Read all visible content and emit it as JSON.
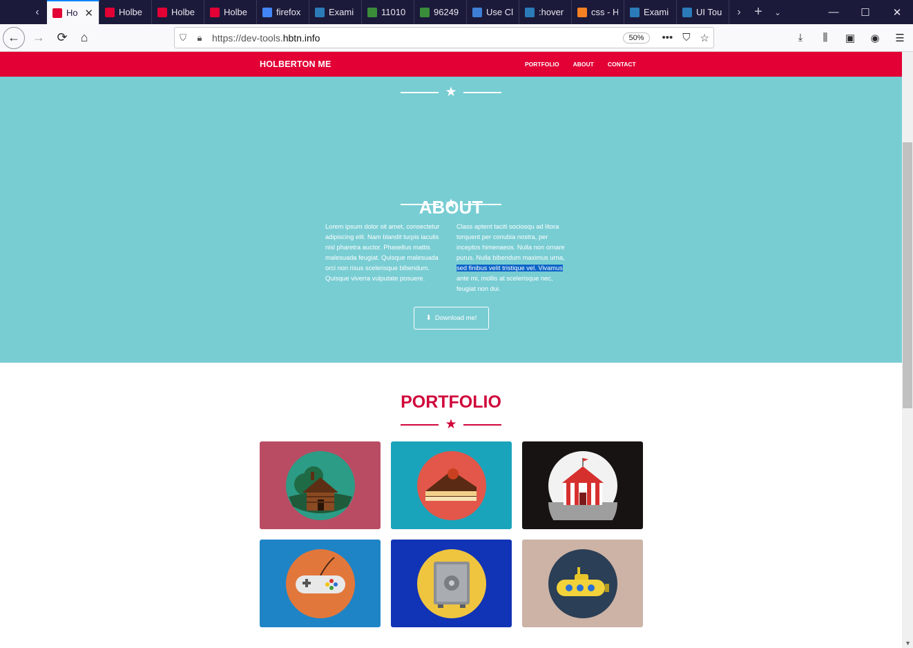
{
  "browser": {
    "tabs": [
      {
        "title": "Ho",
        "favicon": "seahorse-icon",
        "fav_color": "#e20035",
        "active": true
      },
      {
        "title": "Holbe",
        "favicon": "seahorse-icon",
        "fav_color": "#e20035"
      },
      {
        "title": "Holbe",
        "favicon": "seahorse-icon",
        "fav_color": "#e20035"
      },
      {
        "title": "Holbe",
        "favicon": "seahorse-icon",
        "fav_color": "#e20035"
      },
      {
        "title": "firefox",
        "favicon": "google-icon",
        "fav_color": "#4285f4"
      },
      {
        "title": "Exami",
        "favicon": "codepen-icon",
        "fav_color": "#2b7bb9"
      },
      {
        "title": "11010",
        "favicon": "bug-icon",
        "fav_color": "#3a8c3a"
      },
      {
        "title": "96249",
        "favicon": "bug-icon",
        "fav_color": "#3a8c3a"
      },
      {
        "title": "Use Cl",
        "favicon": "dots-icon",
        "fav_color": "#3d7fd6"
      },
      {
        "title": ":hover",
        "favicon": "codepen-icon",
        "fav_color": "#2b7bb9"
      },
      {
        "title": "css - H",
        "favicon": "stackoverflow-icon",
        "fav_color": "#f48024"
      },
      {
        "title": "Exami",
        "favicon": "codepen-icon",
        "fav_color": "#2b7bb9"
      },
      {
        "title": "UI Tou",
        "favicon": "codepen-icon",
        "fav_color": "#2b7bb9"
      }
    ],
    "url_prefix": "https://dev-tools.",
    "url_domain": "hbtn.info",
    "zoom": "50%"
  },
  "site": {
    "brand": "HOLBERTON ME",
    "nav": {
      "portfolio": "PORTFOLIO",
      "about": "ABOUT",
      "contact": "CONTACT"
    },
    "about": {
      "title": "ABOUT",
      "col1": "Lorem ipsum dolor sit amet, consectetur adipiscing elit. Nam blandit turpis iaculis nisl pharetra auctor. Phasellus mattis malesuada feugiat. Quisque malesuada orci non risus scelerisque bibendum. Quisque viverra vulputate posuere.",
      "col2_before": "Class aptent taciti sociosqu ad litora torquent per conubia nostra, per inceptos himenaeos. Nulla non ornare purus. Nulla bibendum maximus urna, ",
      "col2_selected": "sed finibus velit tristique vel. Vivamus",
      "col2_after": " ante mi, mollis at scelerisque nec, feugiat non dui.",
      "download_label": "Download me!"
    },
    "portfolio": {
      "title": "PORTFOLIO",
      "items": [
        {
          "icon": "cabin-icon",
          "bg": "#b94c63"
        },
        {
          "icon": "cake-icon",
          "bg": "#1aa4bb"
        },
        {
          "icon": "circus-tent-icon",
          "bg": "#171312"
        },
        {
          "icon": "game-controller-icon",
          "bg": "#1f84c6"
        },
        {
          "icon": "safe-icon",
          "bg": "#1133b5"
        },
        {
          "icon": "submarine-icon",
          "bg": "#ccb3a6"
        }
      ]
    }
  },
  "colors": {
    "brand_red": "#e20035",
    "hero_teal": "#78cdd3",
    "selection": "#0b64c8"
  }
}
